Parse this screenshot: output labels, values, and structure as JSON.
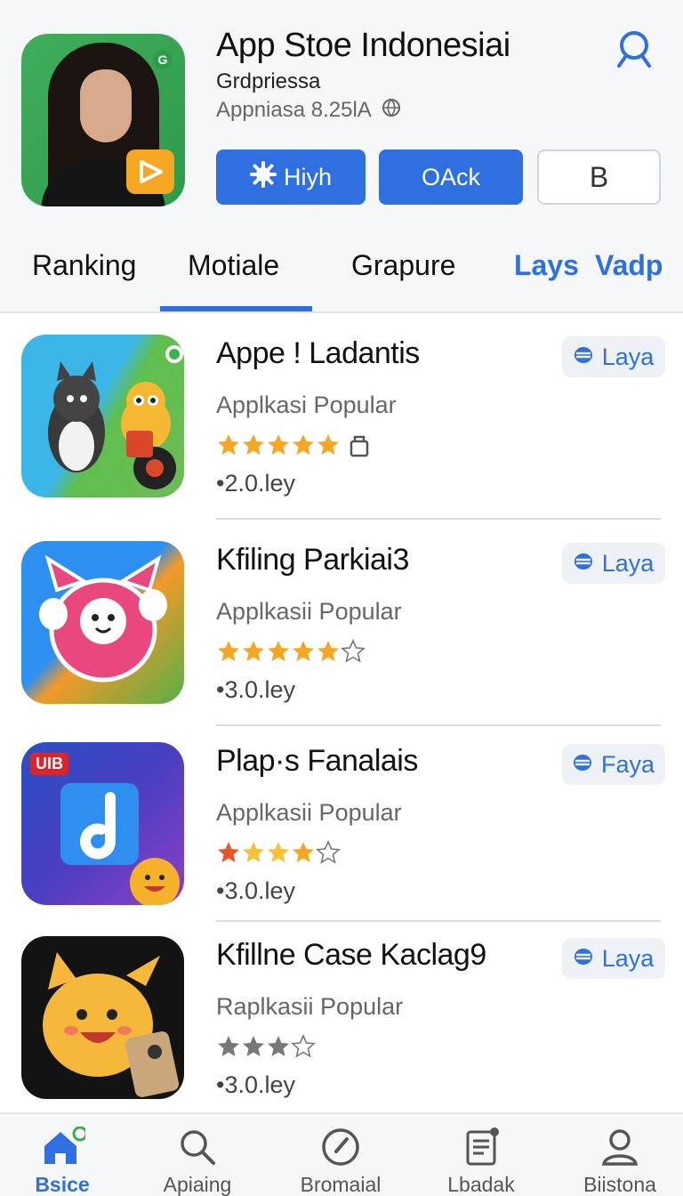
{
  "header": {
    "title": "App Stoe Indonesiai",
    "subtitle": "Grdpriessa",
    "meta": "Appniasa 8.25lA",
    "buttons": {
      "primary1": "Hiyh",
      "primary2": "OAck",
      "secondary": "B"
    }
  },
  "tabs": [
    "Ranking",
    "Motiale",
    "Grapure",
    "Lays",
    "Vadp"
  ],
  "active_tab": "Motiale",
  "apps": [
    {
      "title": "Appe ! Ladantis",
      "subtitle": "Applkasi Popular",
      "rating": 5,
      "size": "•2.0.ley",
      "button": "Laya"
    },
    {
      "title": "Kfiling Parkiai3",
      "subtitle": "Applkasii Popular",
      "rating": 4,
      "size": "•3.0.ley",
      "button": "Laya"
    },
    {
      "title": "Plap·s Fanalais",
      "subtitle": "Applkasii Popular",
      "rating": 4,
      "size": "•3.0.ley",
      "button": "Faya"
    },
    {
      "title": "Kfillne Case Kaclag9",
      "subtitle": "Raplkasii Popular",
      "rating": 3,
      "size": "•3.0.ley",
      "button": "Laya"
    }
  ],
  "icon3_badge": "UIB",
  "bottom_nav": [
    {
      "label": "Bsice",
      "icon": "home-icon",
      "active": true
    },
    {
      "label": "Apiaing",
      "icon": "search-icon",
      "active": false
    },
    {
      "label": "Bromaial",
      "icon": "compass-icon",
      "active": false
    },
    {
      "label": "Lbadak",
      "icon": "clipboard-icon",
      "active": false
    },
    {
      "label": "Biistona",
      "icon": "user-icon",
      "active": false
    }
  ],
  "colors": {
    "accent": "#2f6fe0",
    "star": "#f5a623",
    "background": "#f6f7f9"
  }
}
